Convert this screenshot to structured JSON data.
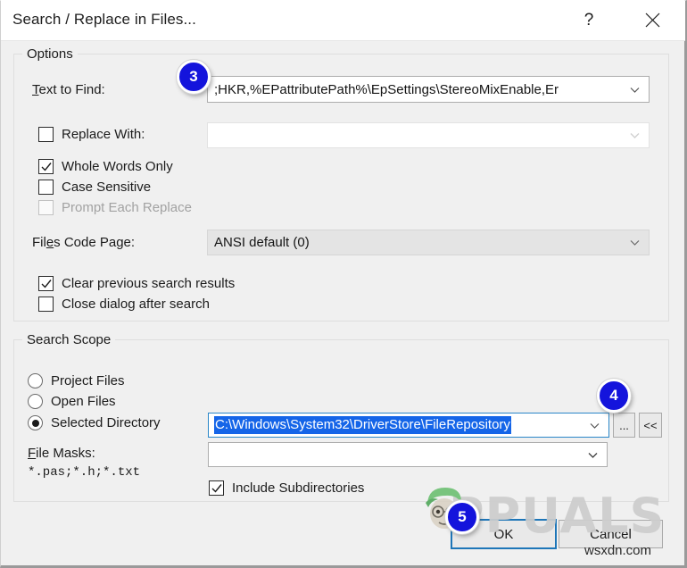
{
  "window": {
    "title": "Search / Replace in Files...",
    "help_icon": "question-mark-icon",
    "close_icon": "close-x-icon"
  },
  "options": {
    "legend": "Options",
    "text_to_find": {
      "label_pre": "T",
      "label_post": "ext to Find:",
      "value": ";HKR,%EPattributePath%\\EpSettings\\StereoMixEnable,Er",
      "placeholder": ""
    },
    "replace_with": {
      "label": "Replace With:",
      "checked": false,
      "value": "",
      "placeholder": ""
    },
    "checkboxes": [
      {
        "label": "Whole Words Only",
        "checked": true,
        "disabled": false
      },
      {
        "label": "Case Sensitive",
        "checked": false,
        "disabled": false
      },
      {
        "label": "Prompt Each Replace",
        "checked": false,
        "disabled": true
      }
    ],
    "code_page": {
      "label_pre": "Fil",
      "label_mid": "e",
      "label_post": "s Code Page:",
      "value": "ANSI default (0)"
    },
    "result_checkboxes": [
      {
        "label": "Clear previous search results",
        "checked": true
      },
      {
        "label": "Close dialog after search",
        "checked": false
      }
    ]
  },
  "scope": {
    "legend": "Search Scope",
    "radios": [
      {
        "label": "Project Files",
        "selected": false
      },
      {
        "label": "Open Files",
        "selected": false
      },
      {
        "label": "Selected Directory",
        "selected": true
      }
    ],
    "directory": {
      "value": "C:\\Windows\\System32\\DriverStore\\FileRepository",
      "selected_text": true
    },
    "browse_button": "...",
    "collapse_button": "<<",
    "file_masks": {
      "label_pre": "F",
      "label_post": "ile Masks:",
      "hint": "*.pas;*.h;*.txt",
      "value": "",
      "placeholder": ""
    },
    "include_subdirs": {
      "label": "Include Subdirectories",
      "checked": true
    }
  },
  "footer": {
    "ok": "OK",
    "cancel": "Cancel"
  },
  "badges": [
    {
      "number": "3"
    },
    {
      "number": "4"
    },
    {
      "number": "5"
    }
  ],
  "watermark": {
    "brand": "PPUALS",
    "site": "wsxdn.com"
  },
  "colors": {
    "dialog_bg": "#f0f0f0",
    "badge_blue": "#1414dc",
    "selection_blue": "#1565e8",
    "focus_blue": "#1e76b8"
  }
}
